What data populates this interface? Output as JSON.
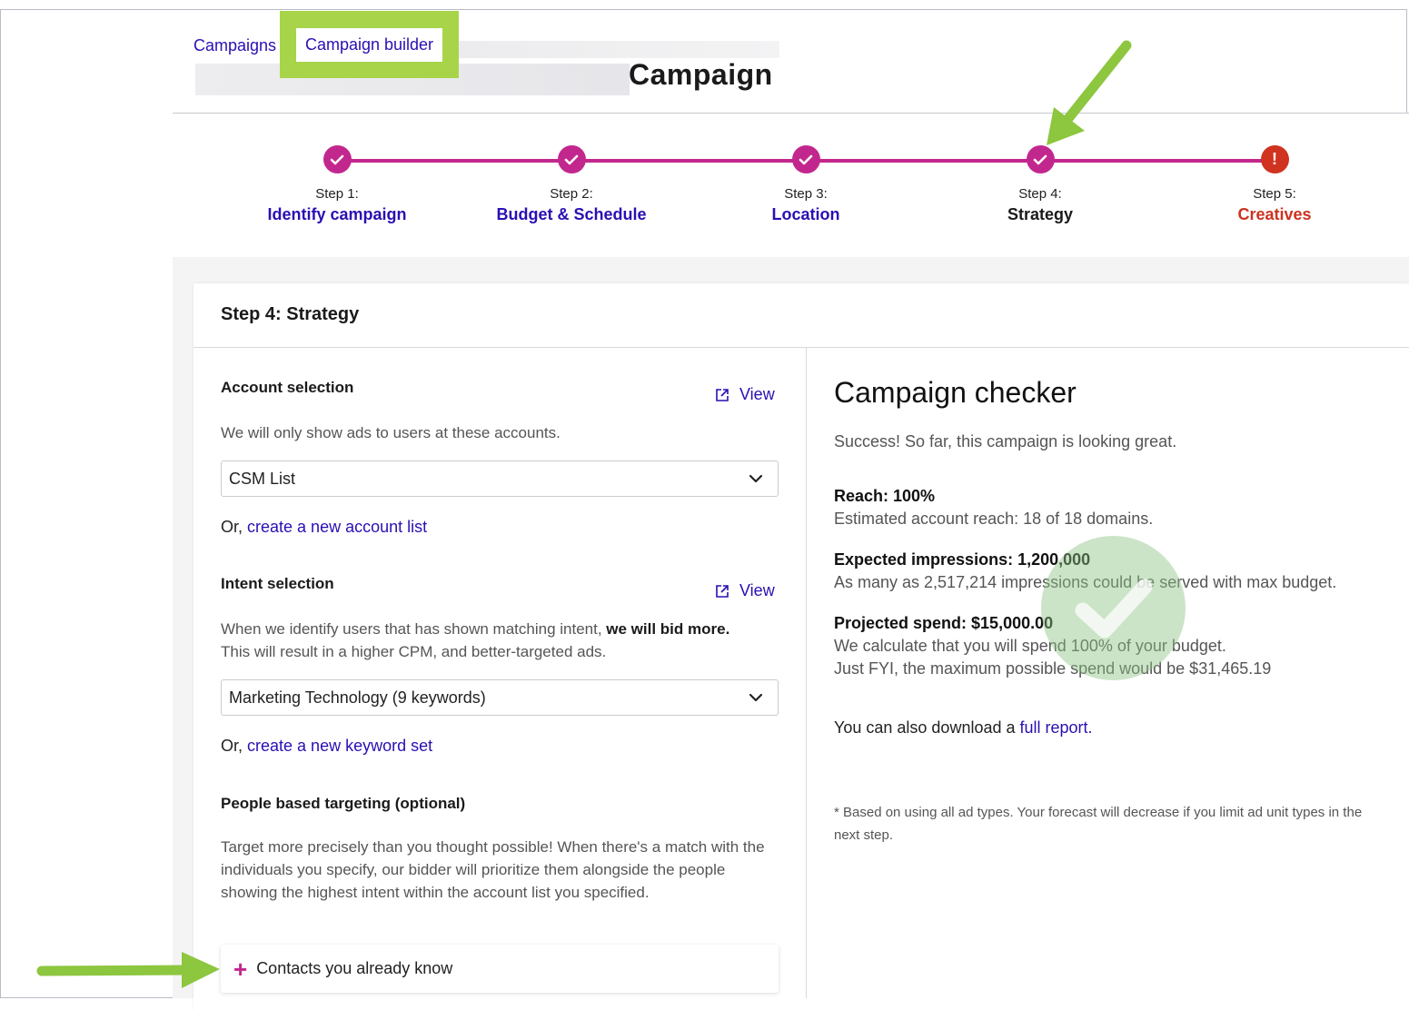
{
  "breadcrumbs": {
    "campaigns": "Campaigns",
    "builder": "Campaign builder"
  },
  "page_title": "Campaign",
  "steps": [
    {
      "num": "Step 1:",
      "label": "Identify campaign",
      "status": "done",
      "icon": "check-icon"
    },
    {
      "num": "Step 2:",
      "label": "Budget & Schedule",
      "status": "done",
      "icon": "check-icon"
    },
    {
      "num": "Step 3:",
      "label": "Location",
      "status": "done",
      "icon": "check-icon"
    },
    {
      "num": "Step 4:",
      "label": "Strategy",
      "status": "current",
      "icon": "check-icon"
    },
    {
      "num": "Step 5:",
      "label": "Creatives",
      "status": "error",
      "icon": "exclamation-icon",
      "glyph": "!"
    }
  ],
  "card_title": "Step 4: Strategy",
  "account": {
    "title": "Account selection",
    "view": "View",
    "desc": "We will only show ads to users at these accounts.",
    "selected": "CSM List",
    "or": "Or, ",
    "create_link": "create a new account list"
  },
  "intent": {
    "title": "Intent selection",
    "view": "View",
    "desc_pre": "When we identify users that has shown matching intent, ",
    "desc_bold": "we will bid more.",
    "desc_post": "This will result in a higher CPM, and better-targeted ads.",
    "selected": "Marketing Technology (9 keywords)",
    "or": "Or, ",
    "create_link": "create a new keyword set"
  },
  "people": {
    "title": "People based targeting (optional)",
    "desc": "Target more precisely than you thought possible! When there's a match with the individuals you specify, our bidder will prioritize them alongside the people showing the highest intent within the account list you specified.",
    "button": "Contacts you already know"
  },
  "checker": {
    "title": "Campaign checker",
    "success": "Success! So far, this campaign is looking great.",
    "reach_label": "Reach: 100%",
    "reach_desc": "Estimated account reach: 18 of 18 domains.",
    "impr_label": "Expected impressions: 1,200,000",
    "impr_desc": "As many as 2,517,214 impressions could be served with max budget.",
    "spend_label": "Projected spend: $15,000.00",
    "spend_desc1": "We calculate that you will spend 100% of your budget.",
    "spend_desc2": "Just FYI, the maximum possible spend would be $31,465.19",
    "download_pre": "You can also download a ",
    "download_link": "full report.",
    "footnote": "* Based on using all ad types. Your forecast will decrease if you limit ad unit types in the next step."
  },
  "colors": {
    "accent": "#c2278e",
    "link": "#2a0fb3",
    "error": "#d0331f",
    "highlight": "#a8d44a"
  }
}
